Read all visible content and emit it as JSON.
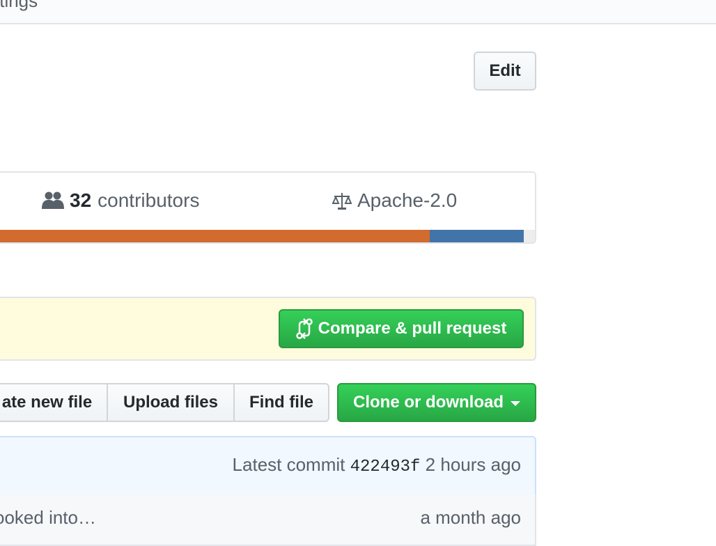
{
  "topnav": {
    "tab_partial": "ttings"
  },
  "header": {
    "edit_label": "Edit"
  },
  "summary": {
    "contributors_count": "32",
    "contributors_label": "contributors",
    "license": "Apache-2.0",
    "language_bar": [
      {
        "color": "#d26b2e",
        "percent": 80.5
      },
      {
        "color": "#4174a8",
        "percent": 17.5
      },
      {
        "color": "#ededed",
        "percent": 2.0
      }
    ]
  },
  "banner": {
    "compare_label": "Compare & pull request"
  },
  "file_actions": {
    "create_label": "ate new file",
    "upload_label": "Upload files",
    "find_label": "Find file",
    "clone_label": "Clone or download"
  },
  "commit": {
    "latest_prefix": "Latest commit",
    "sha": "422493f",
    "time": "2 hours ago"
  },
  "files": [
    {
      "message": "ooked into…",
      "age": "a month ago"
    }
  ]
}
